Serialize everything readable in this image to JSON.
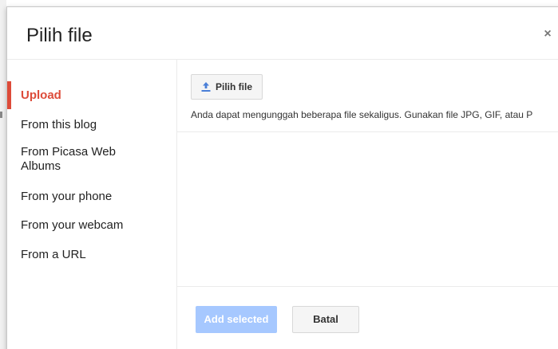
{
  "dialog": {
    "title": "Pilih file",
    "close_label": "×"
  },
  "sidebar": {
    "items": [
      {
        "label": "Upload",
        "active": true
      },
      {
        "label": "From this blog",
        "active": false
      },
      {
        "label": "From Picasa Web Albums",
        "active": false
      },
      {
        "label": "From your phone",
        "active": false
      },
      {
        "label": "From your webcam",
        "active": false
      },
      {
        "label": "From a URL",
        "active": false
      }
    ]
  },
  "upload": {
    "choose_button_label": "Pilih file",
    "choose_button_icon": "upload-icon",
    "info_text": "Anda dapat mengunggah beberapa file sekaligus. Gunakan file JPG, GIF, atau P"
  },
  "footer": {
    "add_label": "Add selected",
    "cancel_label": "Batal"
  },
  "colors": {
    "accent": "#dd4b39",
    "primary_disabled": "#a6c8ff",
    "button_bg": "#f5f5f5",
    "border": "#d8d8d8",
    "text": "#222222"
  }
}
